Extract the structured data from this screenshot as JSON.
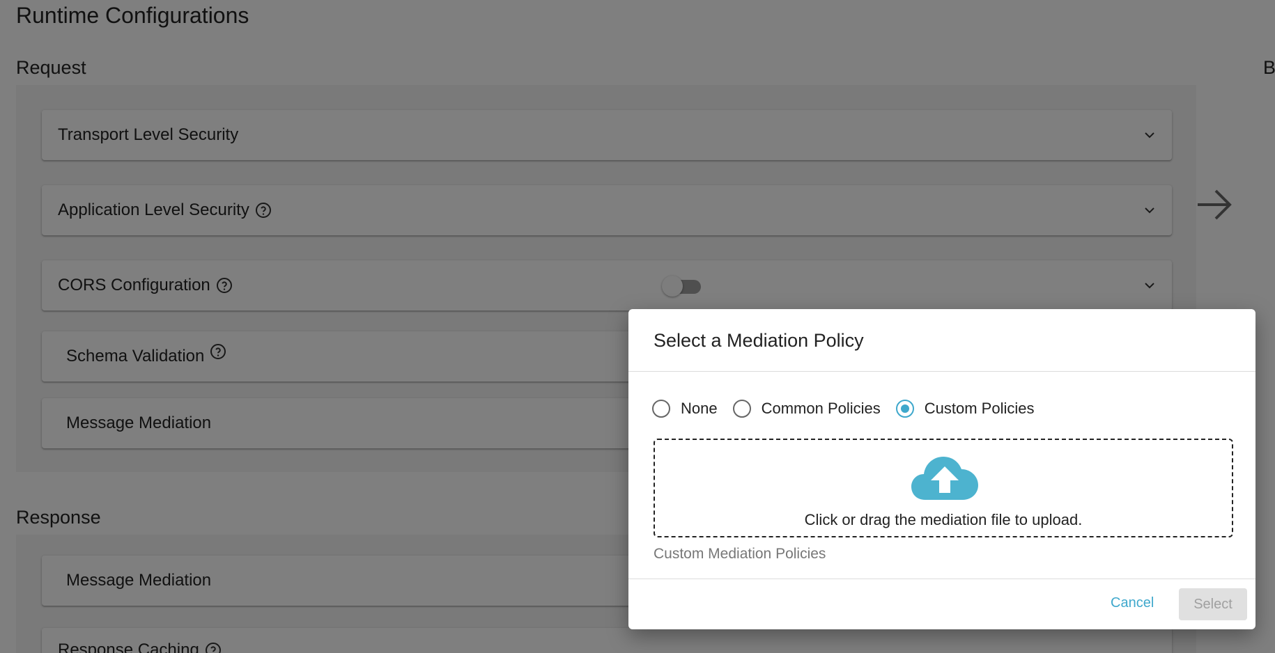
{
  "page": {
    "title": "Runtime Configurations"
  },
  "request": {
    "heading": "Request",
    "items": [
      {
        "label": "Transport Level Security"
      },
      {
        "label": "Application Level Security"
      },
      {
        "label": "CORS Configuration"
      },
      {
        "label": "Schema Validation"
      },
      {
        "label": "Message Mediation"
      }
    ]
  },
  "right_column": {
    "heading_cut": "B"
  },
  "response": {
    "heading": "Response",
    "items": [
      {
        "label": "Message Mediation"
      },
      {
        "label": "Response Caching"
      }
    ]
  },
  "dialog": {
    "title": "Select a Mediation Policy",
    "options": [
      {
        "label": "None",
        "checked": false
      },
      {
        "label": "Common Policies",
        "checked": false
      },
      {
        "label": "Custom Policies",
        "checked": true
      }
    ],
    "dropzone_text": "Click or drag the mediation file to upload.",
    "section_caption": "Custom Mediation Policies",
    "cancel_label": "Cancel",
    "select_label": "Select"
  },
  "colors": {
    "accent": "#3fa8cc",
    "upload_icon": "#4db3cf",
    "overlay": "rgba(0,0,0,0.5)",
    "disabled_button": "#e0e0e0"
  },
  "icons": {
    "help": "help-circle-icon",
    "expand": "chevron-down-icon",
    "arrow": "arrow-right-icon",
    "upload": "cloud-upload-icon"
  }
}
